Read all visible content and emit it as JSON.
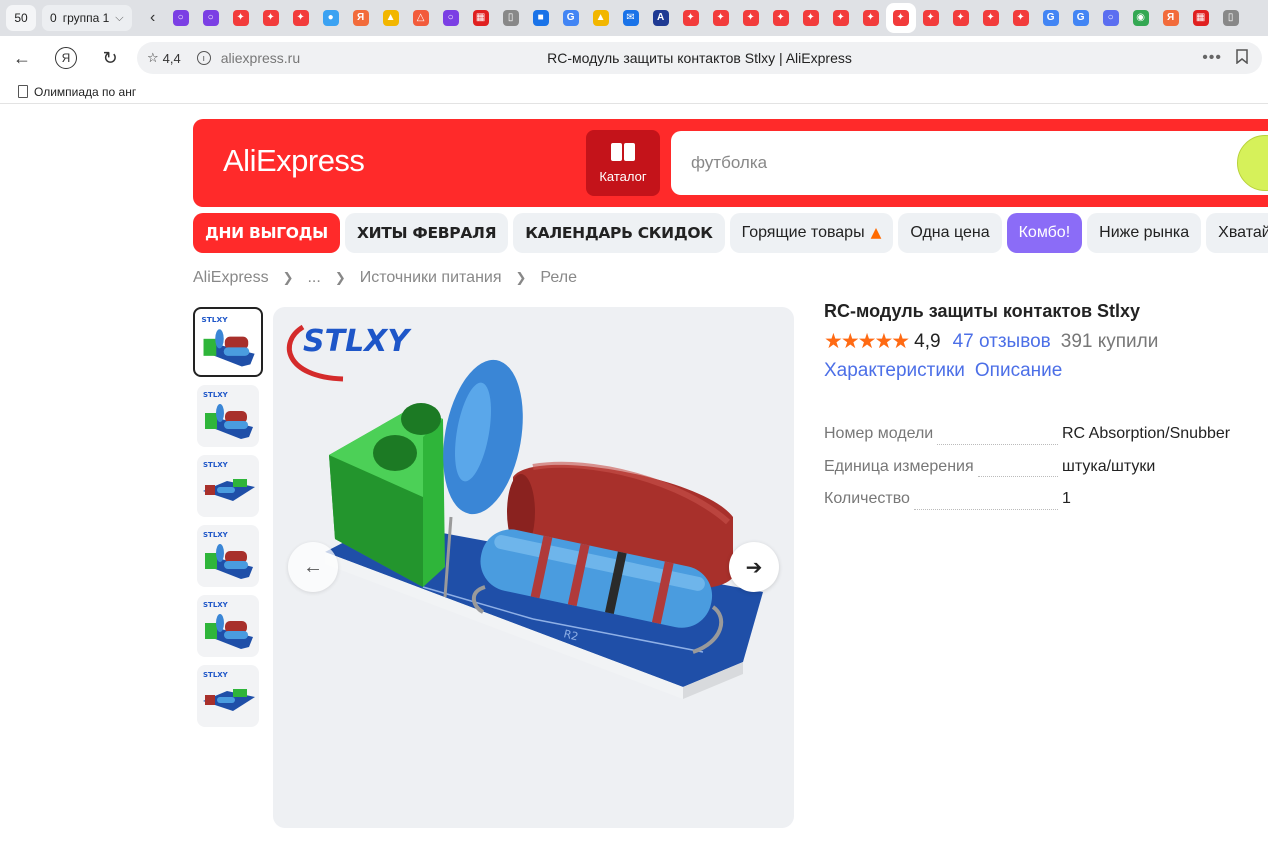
{
  "browser": {
    "tab_count": "50",
    "tab_group": {
      "count": "0",
      "label": "группа 1"
    },
    "tabs": [
      {
        "icon": "purple-ring",
        "color": "#7b3fe4",
        "glyph": "○"
      },
      {
        "icon": "purple-ring",
        "color": "#7b3fe4",
        "glyph": "○"
      },
      {
        "icon": "red-plus",
        "color": "#f23b3b",
        "glyph": "✦"
      },
      {
        "icon": "red-plus",
        "color": "#f23b3b",
        "glyph": "✦"
      },
      {
        "icon": "red-plus",
        "color": "#f23b3b",
        "glyph": "✦"
      },
      {
        "icon": "colorful-dots",
        "color": "#3ba2f2",
        "glyph": "●"
      },
      {
        "icon": "yandex",
        "color": "#f26b3b",
        "glyph": "Я"
      },
      {
        "icon": "picture",
        "color": "#f2b600",
        "glyph": "▲"
      },
      {
        "icon": "triangle",
        "color": "#f25b3b",
        "glyph": "△"
      },
      {
        "icon": "purple-ring",
        "color": "#7b3fe4",
        "glyph": "○"
      },
      {
        "icon": "red-grid",
        "color": "#e02020",
        "glyph": "▦"
      },
      {
        "icon": "document",
        "color": "#888888",
        "glyph": "▯"
      },
      {
        "icon": "blue-square",
        "color": "#1a73e8",
        "glyph": "■"
      },
      {
        "icon": "google",
        "color": "#4285f4",
        "glyph": "G"
      },
      {
        "icon": "picture",
        "color": "#f2b600",
        "glyph": "▲"
      },
      {
        "icon": "mail",
        "color": "#1a73e8",
        "glyph": "✉"
      },
      {
        "icon": "letter-a",
        "color": "#1f3a93",
        "glyph": "A"
      },
      {
        "icon": "red-plus",
        "color": "#f23b3b",
        "glyph": "✦"
      },
      {
        "icon": "red-plus",
        "color": "#f23b3b",
        "glyph": "✦"
      },
      {
        "icon": "red-plus",
        "color": "#f23b3b",
        "glyph": "✦"
      },
      {
        "icon": "red-plus",
        "color": "#f23b3b",
        "glyph": "✦"
      },
      {
        "icon": "red-plus",
        "color": "#f23b3b",
        "glyph": "✦"
      },
      {
        "icon": "red-plus",
        "color": "#f23b3b",
        "glyph": "✦"
      },
      {
        "icon": "red-plus",
        "color": "#f23b3b",
        "glyph": "✦"
      },
      {
        "icon": "red-plus",
        "color": "#f23b3b",
        "glyph": "✦",
        "active": true
      },
      {
        "icon": "red-plus",
        "color": "#f23b3b",
        "glyph": "✦"
      },
      {
        "icon": "red-plus",
        "color": "#f23b3b",
        "glyph": "✦"
      },
      {
        "icon": "red-plus",
        "color": "#f23b3b",
        "glyph": "✦"
      },
      {
        "icon": "red-plus",
        "color": "#f23b3b",
        "glyph": "✦"
      },
      {
        "icon": "google",
        "color": "#4285f4",
        "glyph": "G"
      },
      {
        "icon": "google",
        "color": "#4285f4",
        "glyph": "G"
      },
      {
        "icon": "blue-ring",
        "color": "#5b6ef0",
        "glyph": "○"
      },
      {
        "icon": "chrome",
        "color": "#34a853",
        "glyph": "◉"
      },
      {
        "icon": "yandex",
        "color": "#f26b3b",
        "glyph": "Я"
      },
      {
        "icon": "red-grid",
        "color": "#e02020",
        "glyph": "▦"
      },
      {
        "icon": "document",
        "color": "#888888",
        "glyph": "▯"
      }
    ],
    "address": {
      "site_rating": "4,4",
      "domain": "aliexpress.ru",
      "page_title": "RC-модуль защиты контактов Stlxy | AliExpress"
    },
    "bookmarks": [
      {
        "label": "Олимпиада по анг"
      }
    ]
  },
  "header": {
    "logo": "AliExpress",
    "catalog_label": "Каталог",
    "search_placeholder": "футболка",
    "brand_color": "#ff2a2a",
    "search_button_color": "#d6f15a"
  },
  "promo_chips": [
    {
      "label": "ДНИ ВЫГОДЫ",
      "style": "bold red"
    },
    {
      "label": "ХИТЫ ФЕВРАЛЯ",
      "style": "bold"
    },
    {
      "label": "КАЛЕНДАРЬ СКИДОК",
      "style": "bold"
    },
    {
      "label": "Горящие товары",
      "style": "fire"
    },
    {
      "label": "Одна цена",
      "style": ""
    },
    {
      "label": "Комбо!",
      "style": "purple"
    },
    {
      "label": "Ниже рынка",
      "style": ""
    },
    {
      "label": "Хватай ку",
      "style": ""
    }
  ],
  "breadcrumb": [
    "AliExpress",
    "...",
    "Источники питания",
    "Реле"
  ],
  "gallery": {
    "thumbnail_count": 6,
    "selected_index": 0,
    "brand_watermark": "STLXY"
  },
  "product": {
    "title": "RC-модуль защиты контактов Stlxy",
    "rating": "4,9",
    "stars": 5,
    "reviews": "47 отзывов",
    "bought": "391 купили",
    "links": [
      "Характеристики",
      "Описание"
    ],
    "specs": [
      {
        "key": "Номер модели",
        "value": "RC Absorption/Snubber"
      },
      {
        "key": "Единица измерения",
        "value": "штука/штуки"
      },
      {
        "key": "Количество",
        "value": "1"
      }
    ]
  }
}
